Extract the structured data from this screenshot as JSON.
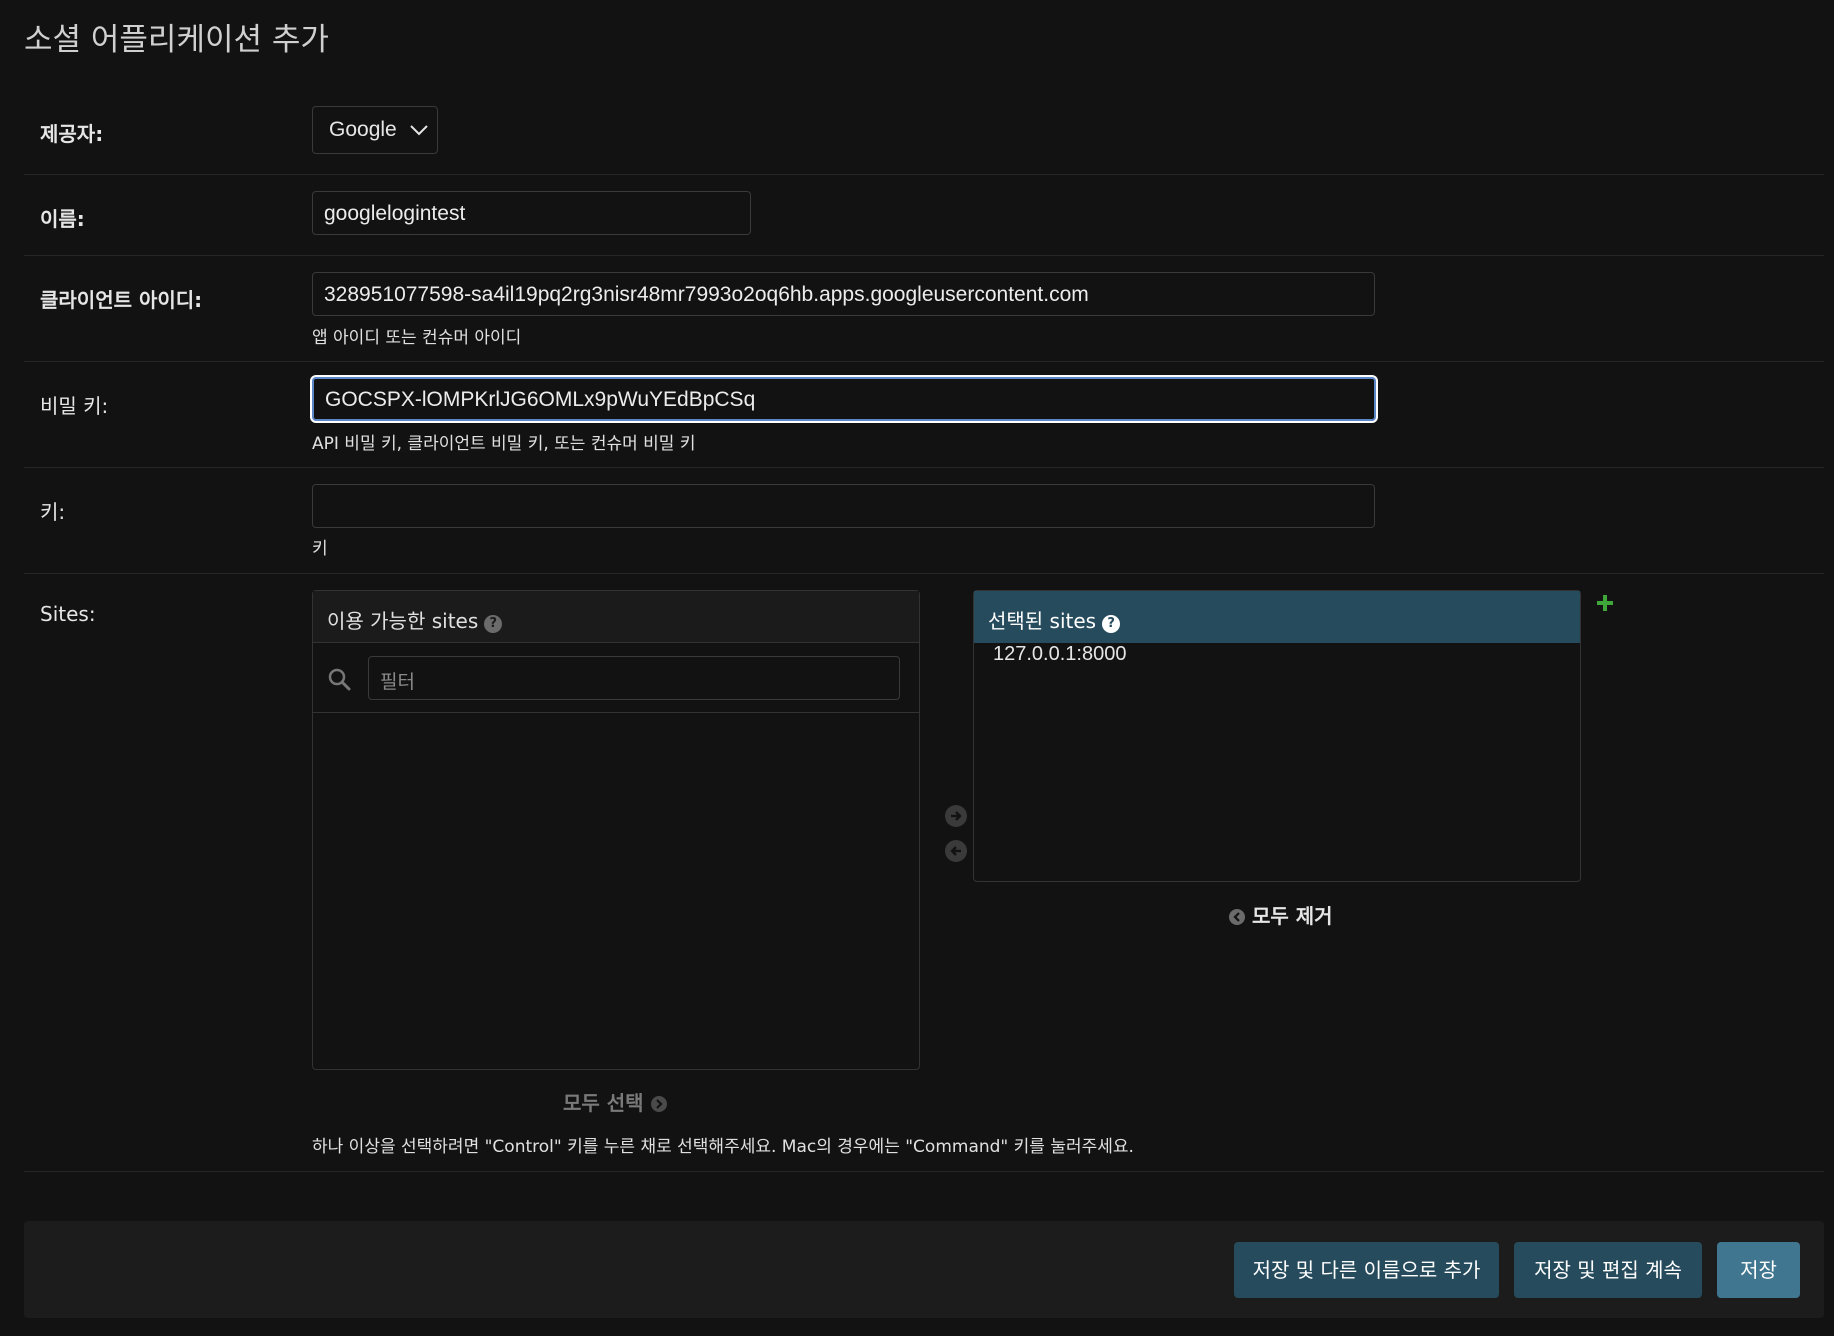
{
  "page": {
    "title": "소셜 어플리케이션 추가"
  },
  "form": {
    "provider": {
      "label": "제공자:",
      "value": "Google"
    },
    "name": {
      "label": "이름:",
      "value": "googlelogintest"
    },
    "client_id": {
      "label": "클라이언트 아이디:",
      "value": "328951077598-sa4il19pq2rg3nisr48mr7993o2oq6hb.apps.googleusercontent.com",
      "help": "앱 아이디 또는 컨슈머 아이디"
    },
    "secret": {
      "label": "비밀 키:",
      "value": "GOCSPX-lOMPKrlJG6OMLx9pWuYEdBpCSq",
      "help": "API 비밀 키, 클라이언트 비밀 키, 또는 컨슈머 비밀 키"
    },
    "key": {
      "label": "키:",
      "value": "",
      "help": "키"
    },
    "sites": {
      "label": "Sites:",
      "available_title": "이용 가능한 sites",
      "filter_placeholder": "필터",
      "available_items": [],
      "chosen_title": "선택된 sites",
      "chosen_items": [
        "127.0.0.1:8000"
      ],
      "choose_all": "모두 선택",
      "remove_all": "모두 제거",
      "help": "하나 이상을 선택하려면 \"Control\" 키를 누른 채로 선택해주세요. Mac의 경우에는 \"Command\" 키를 눌러주세요."
    }
  },
  "buttons": {
    "save_add_another": "저장 및 다른 이름으로 추가",
    "save_continue": "저장 및 편집 계속",
    "save": "저장"
  },
  "colors": {
    "background": "#121212",
    "header_chosen": "#264b5d",
    "button": "#264b5d",
    "button_default": "#417690",
    "add_icon": "#3fa63a",
    "focus_ring": "#5b87c7"
  }
}
